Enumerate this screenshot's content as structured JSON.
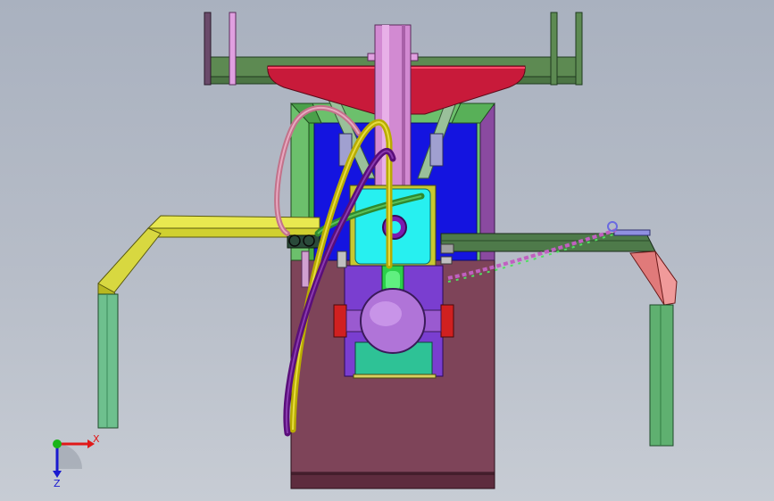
{
  "viewport": {
    "background_top": "#a9b1bf",
    "background_bottom": "#c7ccd4"
  },
  "triad": {
    "x_label": "X",
    "z_label": "Z",
    "x_color": "#e01818",
    "y_color": "#19b419",
    "z_color": "#1a1ad0"
  },
  "colors": {
    "top_frame": "#5d8a52",
    "hopper": "#c81a3a",
    "mast": "#d28ad2",
    "body": "#7e4459",
    "cabinet": "#1414e0",
    "cabinet_frame": "#6cc06c",
    "cabinet_side": "#8a4aa0",
    "cyan_block": "#27f0f0",
    "lower_panel": "#7a3ed0",
    "green_block": "#2ec296",
    "motor": "#b074d8",
    "left_arm": "#e0e040",
    "left_leg": "#6ec08e",
    "right_arm": "#4e7a4a",
    "right_leg": "#5fb070",
    "right_brace": "#e07a7a",
    "hose_yellow": "#b8ac00",
    "hose_purple": "#5a0e7a",
    "hose_pink": "#c2728a",
    "hose_green": "#2f8a2f",
    "chain": "#c060c0"
  }
}
